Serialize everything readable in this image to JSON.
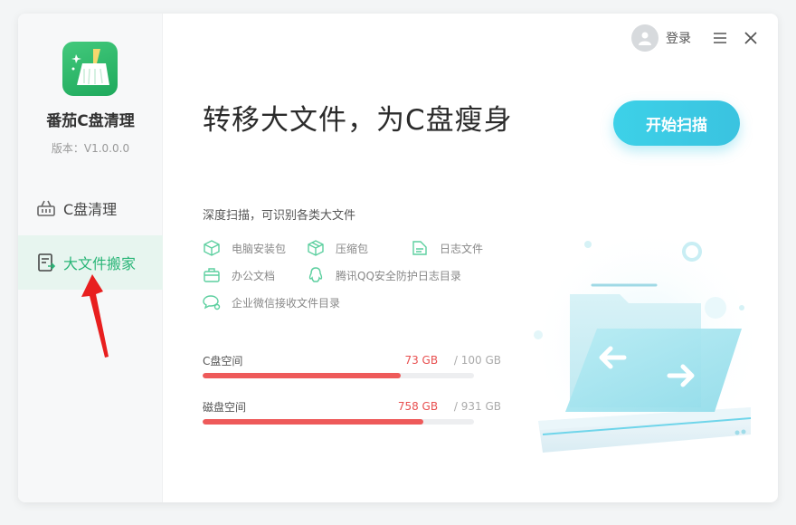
{
  "app": {
    "name": "番茄C盘清理",
    "version": "版本：V1.0.0.0"
  },
  "sidebar": {
    "items": [
      {
        "label": "C盘清理",
        "icon": "basket-icon",
        "active": false
      },
      {
        "label": "大文件搬家",
        "icon": "file-move-icon",
        "active": true
      }
    ]
  },
  "header": {
    "login_label": "登录"
  },
  "main": {
    "headline": "转移大文件，为C盘瘦身",
    "scan_button": "开始扫描",
    "subtitle": "深度扫描，可识别各类大文件",
    "features": [
      {
        "label": "电脑安装包",
        "icon": "package-icon"
      },
      {
        "label": "压缩包",
        "icon": "archive-icon"
      },
      {
        "label": "日志文件",
        "icon": "log-file-icon"
      },
      {
        "label": "办公文档",
        "icon": "briefcase-icon"
      },
      {
        "label": "腾讯QQ安全防护日志目录",
        "icon": "qq-icon"
      },
      {
        "label": "企业微信接收文件目录",
        "icon": "wechat-work-icon"
      }
    ],
    "usage": [
      {
        "label": "C盘空间",
        "used": "73 GB",
        "total": "/ 100 GB",
        "fraction": 0.73
      },
      {
        "label": "磁盘空间",
        "used": "758 GB",
        "total": "/ 931 GB",
        "fraction": 0.814
      }
    ]
  },
  "colors": {
    "accent": "#29b577",
    "scan": "#3dd1e8",
    "bar": "#ee5a5a"
  }
}
